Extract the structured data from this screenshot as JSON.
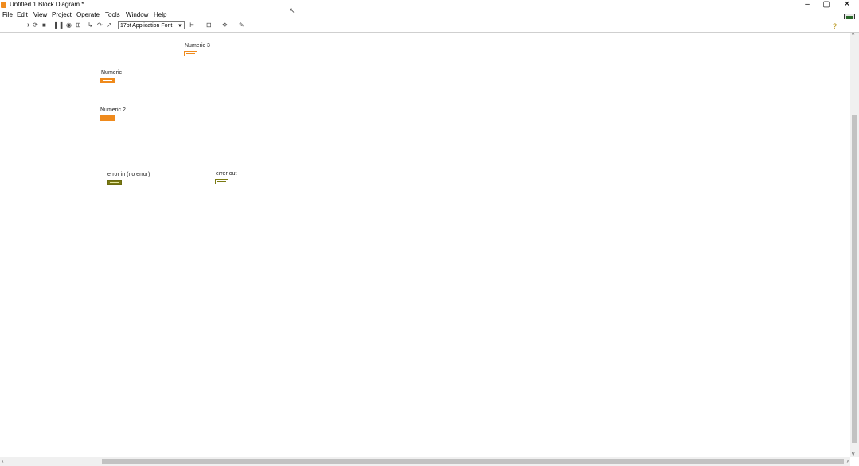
{
  "window": {
    "title": "Untitled 1 Block Diagram *",
    "controls": {
      "minimize": "–",
      "maximize": "▢",
      "close": "✕"
    }
  },
  "menu": {
    "items": [
      "File",
      "Edit",
      "View",
      "Project",
      "Operate",
      "Tools",
      "Window",
      "Help"
    ]
  },
  "toolbar": {
    "font_select": "17pt Application Font"
  },
  "diagram": {
    "nodes": [
      {
        "label": "Numeric 3",
        "kind": "dbl-indicator"
      },
      {
        "label": "Numeric",
        "kind": "dbl-control"
      },
      {
        "label": "Numeric 2",
        "kind": "dbl-control"
      },
      {
        "label": "error in (no error)",
        "kind": "cluster-control"
      },
      {
        "label": "error out",
        "kind": "cluster-indicator"
      }
    ]
  },
  "icons": {
    "app": "labview-icon",
    "run": "run-arrow-icon",
    "help": "context-help-icon"
  },
  "colors": {
    "numeric_terminal": "#ef8a1c",
    "cluster_terminal": "#7a7a12"
  }
}
